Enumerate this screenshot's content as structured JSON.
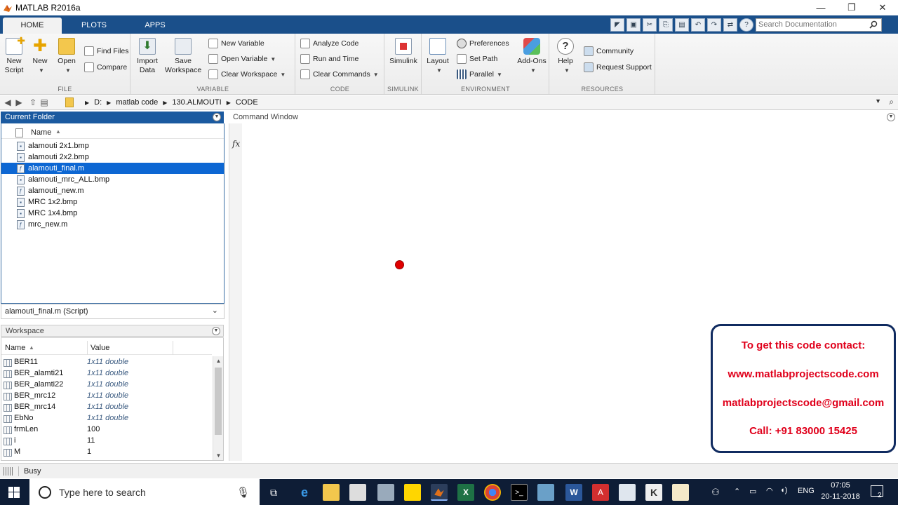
{
  "window": {
    "title": "MATLAB R2016a"
  },
  "tabs": [
    "HOME",
    "PLOTS",
    "APPS"
  ],
  "search": {
    "placeholder": "Search Documentation"
  },
  "ribbon": {
    "file": {
      "label": "FILE",
      "new_script": [
        "New",
        "Script"
      ],
      "new": "New",
      "open": "Open",
      "find_files": "Find Files",
      "compare": "Compare"
    },
    "variable": {
      "label": "VARIABLE",
      "import": [
        "Import",
        "Data"
      ],
      "save": [
        "Save",
        "Workspace"
      ],
      "new_variable": "New Variable",
      "open_variable": "Open Variable",
      "clear_workspace": "Clear Workspace"
    },
    "code": {
      "label": "CODE",
      "analyze": "Analyze Code",
      "run_time": "Run and Time",
      "clear_commands": "Clear Commands"
    },
    "simulink": {
      "label": "SIMULINK",
      "simulink": "Simulink"
    },
    "environment": {
      "label": "ENVIRONMENT",
      "layout": "Layout",
      "preferences": "Preferences",
      "set_path": "Set Path",
      "parallel": "Parallel",
      "addons": "Add-Ons"
    },
    "resources": {
      "label": "RESOURCES",
      "help": "Help",
      "community": "Community",
      "request_support": "Request Support"
    }
  },
  "path": [
    "D:",
    "matlab code",
    "130.ALMOUTI",
    "CODE"
  ],
  "current_folder": {
    "title": "Current Folder",
    "name_col": "Name",
    "files": [
      {
        "name": "alamouti 2x1.bmp",
        "type": "bmp"
      },
      {
        "name": "alamouti 2x2.bmp",
        "type": "bmp"
      },
      {
        "name": "alamouti_final.m",
        "type": "m",
        "selected": true
      },
      {
        "name": "alamouti_mrc_ALL.bmp",
        "type": "bmp"
      },
      {
        "name": "alamouti_new.m",
        "type": "m"
      },
      {
        "name": "MRC 1x2.bmp",
        "type": "bmp"
      },
      {
        "name": "MRC 1x4.bmp",
        "type": "bmp"
      },
      {
        "name": "mrc_new.m",
        "type": "m"
      }
    ],
    "detail": "alamouti_final.m  (Script)"
  },
  "workspace": {
    "title": "Workspace",
    "col_name": "Name",
    "col_value": "Value",
    "rows": [
      {
        "name": "BER11",
        "value": "1x11 double"
      },
      {
        "name": "BER_alamti21",
        "value": "1x11 double"
      },
      {
        "name": "BER_alamti22",
        "value": "1x11 double"
      },
      {
        "name": "BER_mrc12",
        "value": "1x11 double"
      },
      {
        "name": "BER_mrc14",
        "value": "1x11 double"
      },
      {
        "name": "EbNo",
        "value": "1x11 double"
      },
      {
        "name": "frmLen",
        "value": "100"
      },
      {
        "name": "i",
        "value": "11"
      },
      {
        "name": "M",
        "value": "1"
      }
    ]
  },
  "command_window": {
    "title": "Command Window",
    "prompt": "fx"
  },
  "promo": {
    "line1": "To get this code contact:",
    "line2": "www.matlabprojectscode.com",
    "line3": "matlabprojectscode@gmail.com",
    "line4": "Call: +91 83000 15425"
  },
  "status": {
    "text": "Busy"
  },
  "taskbar": {
    "search_placeholder": "Type here to search",
    "lang": "ENG",
    "time": "07:05",
    "date": "20-11-2018",
    "notifications": "2"
  },
  "colors": {
    "accent": "#1a4f8a",
    "selection": "#0d67d3",
    "promo_text": "#e0001b",
    "promo_border": "#102b60"
  }
}
